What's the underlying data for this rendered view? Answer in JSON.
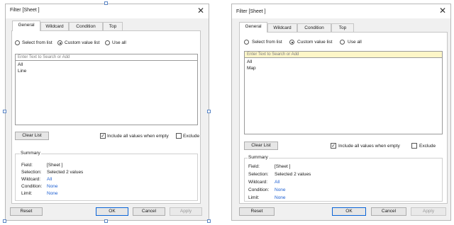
{
  "left_dialog": {
    "title": "Filter [Sheet ]",
    "close": "✕",
    "tabs": [
      "General",
      "Wildcard",
      "Condition",
      "Top"
    ],
    "radios": [
      "Select from list",
      "Custom value list",
      "Use all"
    ],
    "selected_radio": "Custom value list",
    "search_placeholder": "Enter Text to Search or Add",
    "list_items": [
      "All",
      "Line"
    ],
    "clear_list": "Clear List",
    "include_all": "Include all values when empty",
    "include_all_checked": true,
    "exclude": "Exclude",
    "exclude_checked": false,
    "summary": {
      "title": "Summary",
      "field_label": "Field:",
      "field_value": "[Sheet ]",
      "selection_label": "Selection:",
      "selection_value": "Selected 2 values",
      "wildcard_label": "Wildcard:",
      "wildcard_value": "All",
      "condition_label": "Condition:",
      "condition_value": "None",
      "limit_label": "Limit:",
      "limit_value": "None"
    },
    "buttons": {
      "reset": "Reset",
      "ok": "OK",
      "cancel": "Cancel",
      "apply": "Apply"
    }
  },
  "right_dialog": {
    "title": "Filter [Sheet ]",
    "close": "✕",
    "tabs": [
      "General",
      "Wildcard",
      "Condition",
      "Top"
    ],
    "radios": [
      "Select from list",
      "Custom value list",
      "Use all"
    ],
    "selected_radio": "Custom value list",
    "search_placeholder": "Enter Text to Search or Add",
    "list_items": [
      "All",
      "Map"
    ],
    "clear_list": "Clear List",
    "include_all": "Include all values when empty",
    "include_all_checked": true,
    "exclude": "Exclude",
    "exclude_checked": false,
    "summary": {
      "title": "Summary",
      "field_label": "Field:",
      "field_value": "[Sheet ]",
      "selection_label": "Selection:",
      "selection_value": "Selected 2 values",
      "wildcard_label": "Wildcard:",
      "wildcard_value": "All",
      "condition_label": "Condition:",
      "condition_value": "None",
      "limit_label": "Limit:",
      "limit_value": "None"
    },
    "buttons": {
      "reset": "Reset",
      "ok": "OK",
      "cancel": "Cancel",
      "apply": "Apply"
    }
  },
  "colors": {
    "accent": "#0a64d8",
    "link": "#1d5fd1",
    "search_highlight": "#fdf6c8"
  }
}
